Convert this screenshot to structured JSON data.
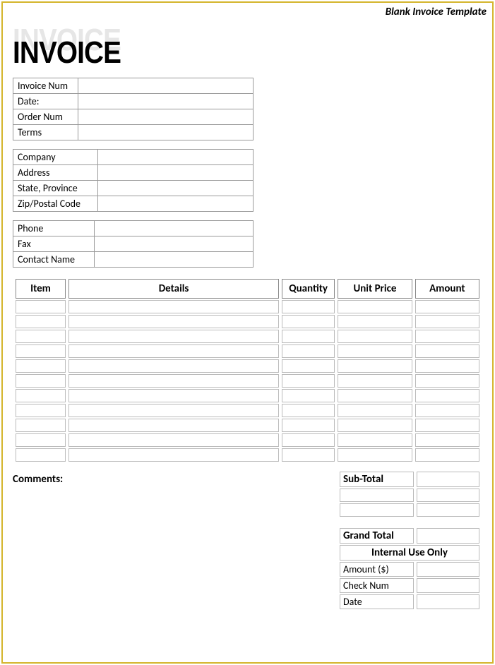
{
  "template_label": "Blank Invoice Template",
  "title": "INVOICE",
  "info1": {
    "rows": [
      {
        "label": "Invoice Num",
        "value": ""
      },
      {
        "label": "Date:",
        "value": ""
      },
      {
        "label": "Order Num",
        "value": ""
      },
      {
        "label": "Terms",
        "value": ""
      }
    ]
  },
  "info2": {
    "rows": [
      {
        "label": "Company",
        "value": ""
      },
      {
        "label": "Address",
        "value": ""
      },
      {
        "label": "State, Province",
        "value": ""
      },
      {
        "label": "Zip/Postal Code",
        "value": ""
      }
    ]
  },
  "info3": {
    "rows": [
      {
        "label": "Phone",
        "value": ""
      },
      {
        "label": "Fax",
        "value": ""
      },
      {
        "label": "Contact Name",
        "value": ""
      }
    ]
  },
  "items": {
    "headers": {
      "item": "Item",
      "details": "Details",
      "quantity": "Quantity",
      "unit_price": "Unit Price",
      "amount": "Amount"
    },
    "rows": [
      {
        "item": "",
        "details": "",
        "quantity": "",
        "unit_price": "",
        "amount": ""
      },
      {
        "item": "",
        "details": "",
        "quantity": "",
        "unit_price": "",
        "amount": ""
      },
      {
        "item": "",
        "details": "",
        "quantity": "",
        "unit_price": "",
        "amount": ""
      },
      {
        "item": "",
        "details": "",
        "quantity": "",
        "unit_price": "",
        "amount": ""
      },
      {
        "item": "",
        "details": "",
        "quantity": "",
        "unit_price": "",
        "amount": ""
      },
      {
        "item": "",
        "details": "",
        "quantity": "",
        "unit_price": "",
        "amount": ""
      },
      {
        "item": "",
        "details": "",
        "quantity": "",
        "unit_price": "",
        "amount": ""
      },
      {
        "item": "",
        "details": "",
        "quantity": "",
        "unit_price": "",
        "amount": ""
      },
      {
        "item": "",
        "details": "",
        "quantity": "",
        "unit_price": "",
        "amount": ""
      },
      {
        "item": "",
        "details": "",
        "quantity": "",
        "unit_price": "",
        "amount": ""
      },
      {
        "item": "",
        "details": "",
        "quantity": "",
        "unit_price": "",
        "amount": ""
      }
    ]
  },
  "comments_label": "Comments:",
  "totals": {
    "sub_total_label": "Sub-Total",
    "sub_total": "",
    "blank1_label": "",
    "blank1": "",
    "blank2_label": "",
    "blank2": "",
    "grand_total_label": "Grand Total",
    "grand_total": ""
  },
  "internal": {
    "header": "Internal Use Only",
    "rows": [
      {
        "label": "Amount ($)",
        "value": ""
      },
      {
        "label": "Check Num",
        "value": ""
      },
      {
        "label": "Date",
        "value": ""
      }
    ]
  }
}
